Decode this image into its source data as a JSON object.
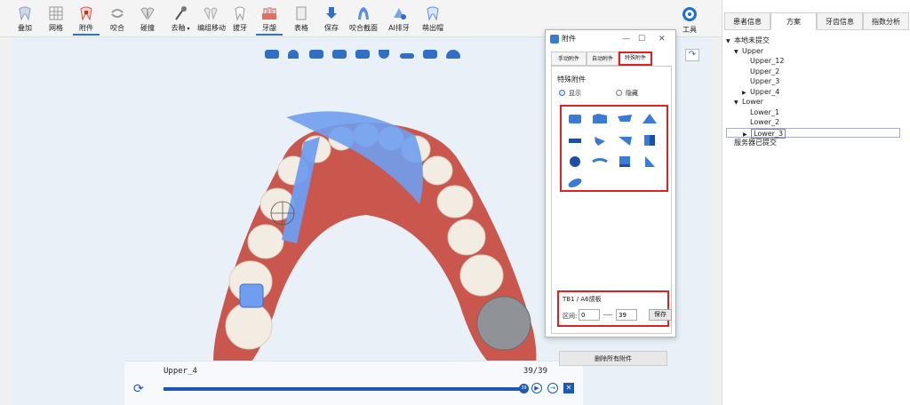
{
  "toolbar": {
    "items": [
      {
        "label": "叠加",
        "icon": "tooth-overlay-icon"
      },
      {
        "label": "网格",
        "icon": "grid-icon"
      },
      {
        "label": "附件",
        "icon": "attachment-icon"
      },
      {
        "label": "咬合",
        "icon": "occlusion-icon"
      },
      {
        "label": "碰撞",
        "icon": "collision-icon"
      },
      {
        "label": "去釉",
        "icon": "ipr-icon"
      },
      {
        "label": "编组移动",
        "icon": "group-move-icon"
      },
      {
        "label": "拔牙",
        "icon": "extraction-icon"
      },
      {
        "label": "牙龈",
        "icon": "gingiva-icon"
      },
      {
        "label": "表格",
        "icon": "table-icon"
      },
      {
        "label": "保存",
        "icon": "save-icon"
      },
      {
        "label": "咬合截面",
        "icon": "bite-section-icon"
      },
      {
        "label": "AI排牙",
        "icon": "ai-arrange-icon"
      },
      {
        "label": "萌出帽",
        "icon": "eruption-cap-icon"
      }
    ],
    "tools_label": "工具"
  },
  "timeline": {
    "name": "Upper_4",
    "count": "39/39",
    "knob": "39"
  },
  "right_panel": {
    "tabs": [
      "患者信息",
      "方案",
      "牙齿信息",
      "指数分析"
    ],
    "active_tab": "方案",
    "tree": [
      {
        "label": "本地未提交",
        "arrow": "▼",
        "level": 0
      },
      {
        "label": "Upper",
        "arrow": "▼",
        "level": 1
      },
      {
        "label": "Upper_12",
        "arrow": "",
        "level": 2
      },
      {
        "label": "Upper_2",
        "arrow": "",
        "level": 2
      },
      {
        "label": "Upper_3",
        "arrow": "",
        "level": 2
      },
      {
        "label": "Upper_4",
        "arrow": "▶",
        "level": 2
      },
      {
        "label": "Lower",
        "arrow": "▼",
        "level": 1
      },
      {
        "label": "Lower_1",
        "arrow": "",
        "level": 2
      },
      {
        "label": "Lower_2",
        "arrow": "",
        "level": 2
      },
      {
        "label": "Lower_3",
        "arrow": "▶",
        "level": 2
      },
      {
        "label": "服务器已提交",
        "arrow": "",
        "level": 0
      }
    ],
    "selected": "Lower_3"
  },
  "dialog": {
    "title": "附件",
    "minimize": "—",
    "maximize": "☐",
    "close": "✕",
    "tabs": [
      "手动附件",
      "自动附件",
      "特殊附件"
    ],
    "active_tab": "特殊附件",
    "section_title": "特殊附件",
    "radio_show": "显示",
    "radio_hide": "隐藏",
    "radio_selected": "显示",
    "shapes": [
      "rect-attachment-icon",
      "flag-attachment-icon",
      "bevel-attachment-icon",
      "wedge-attachment-icon",
      "bar-attachment-icon",
      "prism-attachment-icon",
      "triangle-attachment-icon",
      "cube-attachment-icon",
      "round-attachment-icon",
      "arc-attachment-icon",
      "square-attachment-icon",
      "hook-attachment-icon",
      "capsule-attachment-icon"
    ],
    "tb1_label": "TB1 / A6颌板",
    "range_label": "区间:",
    "range_from": "0",
    "range_to": "39",
    "save_label": "保存",
    "delete_all_label": "删除所有附件"
  },
  "colors": {
    "accent": "#2d72c8",
    "highlight_red": "#e02020",
    "gum": "#c9574e",
    "tooth": "#f3ece2",
    "attachment_blue": "#6f9ef0"
  }
}
